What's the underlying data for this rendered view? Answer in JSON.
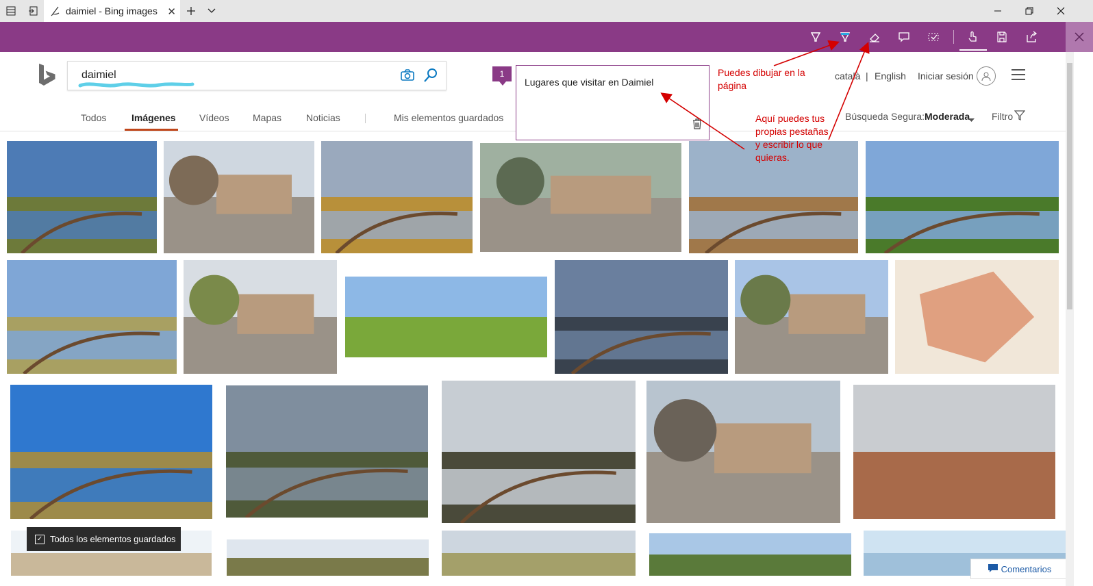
{
  "tab": {
    "title": "daimiel - Bing images"
  },
  "search": {
    "query": "daimiel"
  },
  "header": {
    "catala": "català",
    "separator": "|",
    "english": "English",
    "signin": "Iniciar sesión"
  },
  "nav": {
    "items": [
      "Todos",
      "Imágenes",
      "Vídeos",
      "Mapas",
      "Noticias",
      "Mis elementos guardados"
    ]
  },
  "filters": {
    "safe_label": "Búsqueda Segura:",
    "safe_value": "Moderada",
    "filter_label": "Filtro"
  },
  "note": {
    "number": "1",
    "text": "Lugares que visitar en Daimiel"
  },
  "annotations": {
    "draw": [
      "Puedes dibujar en la",
      "página"
    ],
    "tabs": [
      "Aquí puedes tus",
      "propias pestañas",
      "y escribir lo que",
      "quieras."
    ]
  },
  "saved_bar": {
    "label": "Todos los elementos guardados"
  },
  "feedback": {
    "label": "Comentarios"
  },
  "colors": {
    "ink_toolbar": "#8a3a86",
    "annotation": "#d40000",
    "nav_active_underline": "#c0461a",
    "link_blue": "#1c5aa6"
  },
  "icons": [
    "tab-manager-icon",
    "set-aside-icon",
    "pen-icon",
    "new-tab-icon",
    "chevron-down-icon",
    "ballpoint-pen-icon",
    "highlighter-icon",
    "eraser-icon",
    "add-note-icon",
    "clip-icon",
    "touch-writing-icon",
    "save-icon",
    "share-icon",
    "close-icon",
    "camera-icon",
    "search-icon",
    "trash-icon",
    "user-icon",
    "menu-icon",
    "filter-icon",
    "checkbox-icon",
    "comment-icon"
  ]
}
